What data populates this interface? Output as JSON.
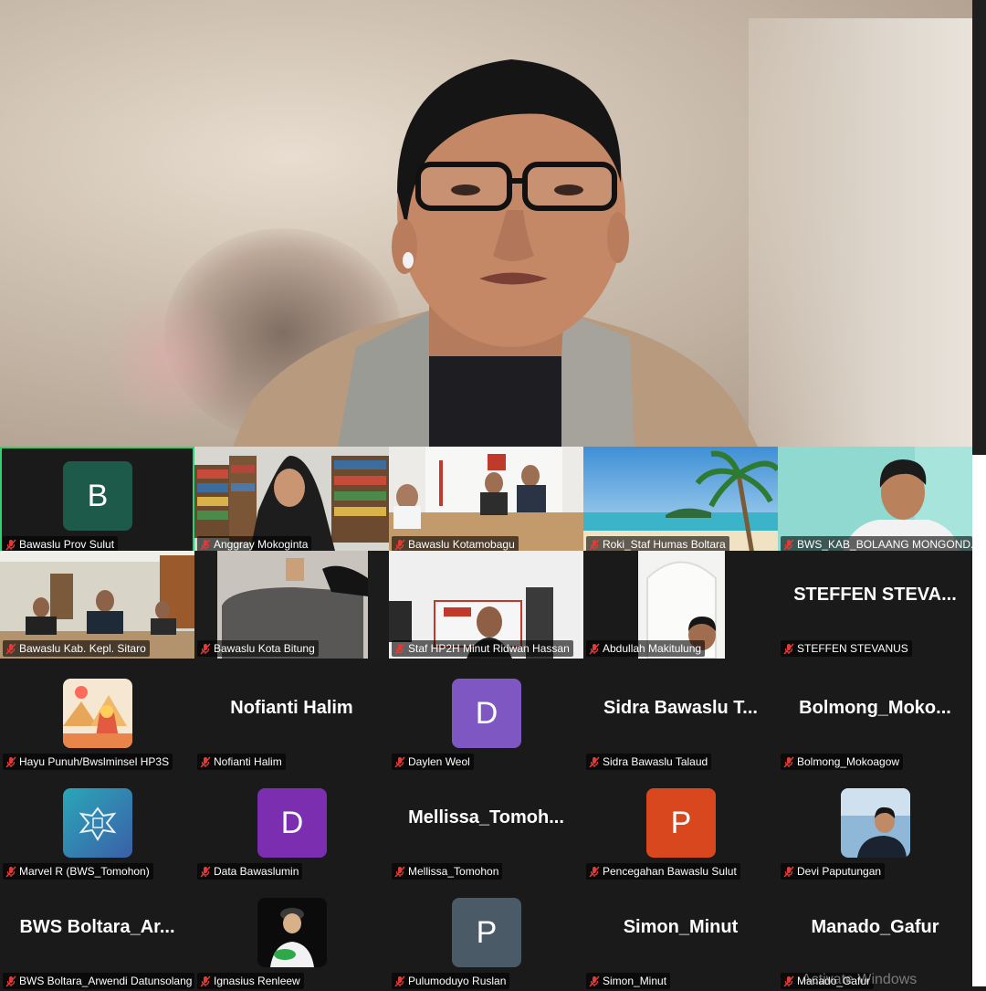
{
  "colors": {
    "background": "#1a1a1a",
    "active_border": "#2dd36f",
    "mic_muted": "#e53935"
  },
  "speaker": {
    "name": ""
  },
  "tiles": [
    {
      "label": "Bawaslu Prov Sulut",
      "type": "avatar",
      "initial": "B",
      "color": "#1e5a4a",
      "active": true
    },
    {
      "label": "Anggray Mokoginta",
      "type": "video",
      "scene": "library"
    },
    {
      "label": "Bawaslu Kotamobagu",
      "type": "video",
      "scene": "office"
    },
    {
      "label": "Roki_Staf Humas Boltara",
      "type": "video",
      "scene": "beach"
    },
    {
      "label": "BWS_KAB_BOLAANG MONGOND...",
      "type": "video",
      "scene": "man"
    },
    {
      "label": "Bawaslu Kab. Kepl. Sitaro",
      "type": "video",
      "scene": "room"
    },
    {
      "label": "Bawaslu Kota Bitung",
      "type": "video",
      "scene": "cup"
    },
    {
      "label": "Staf HP2H Minut Ridwan Hassan",
      "type": "video",
      "scene": "poster"
    },
    {
      "label": "Abdullah Makitulung",
      "type": "video",
      "scene": "arch"
    },
    {
      "label": "STEFFEN STEVANUS",
      "type": "name",
      "big": "STEFFEN  STEVA..."
    },
    {
      "label": "Hayu Punuh/Bwslminsel HP3S",
      "type": "image",
      "image": "sphinx"
    },
    {
      "label": "Nofianti Halim",
      "type": "name",
      "big": "Nofianti Halim"
    },
    {
      "label": "Daylen Weol",
      "type": "avatar",
      "initial": "D",
      "color": "#7e57c2"
    },
    {
      "label": "Sidra Bawaslu Talaud",
      "type": "name",
      "big": "Sidra Bawaslu T..."
    },
    {
      "label": "Bolmong_Mokoagow",
      "type": "name",
      "big": "Bolmong_Moko..."
    },
    {
      "label": "Marvel R (BWS_Tomohon)",
      "type": "image",
      "image": "garuda"
    },
    {
      "label": "Data Bawaslumin",
      "type": "avatar",
      "initial": "D",
      "color": "#7b2fb0"
    },
    {
      "label": "Mellissa_Tomohon",
      "type": "name",
      "big": "Mellissa_Tomoh..."
    },
    {
      "label": "Pencegahan Bawaslu Sulut",
      "type": "avatar",
      "initial": "P",
      "color": "#d9471f"
    },
    {
      "label": "Devi Paputungan",
      "type": "image",
      "image": "photo"
    },
    {
      "label": "BWS Boltara_Arwendi Datunsolang",
      "type": "name",
      "big": "BWS  Boltara_Ar..."
    },
    {
      "label": "Ignasius Renleew",
      "type": "image",
      "image": "cartoon"
    },
    {
      "label": "Pulumoduyo Ruslan",
      "type": "avatar",
      "initial": "P",
      "color": "#4a5a66"
    },
    {
      "label": "Simon_Minut",
      "type": "name",
      "big": "Simon_Minut"
    },
    {
      "label": "Manado_Gafur",
      "type": "name",
      "big": "Manado_Gafur"
    }
  ],
  "watermark": "Activate Windows"
}
